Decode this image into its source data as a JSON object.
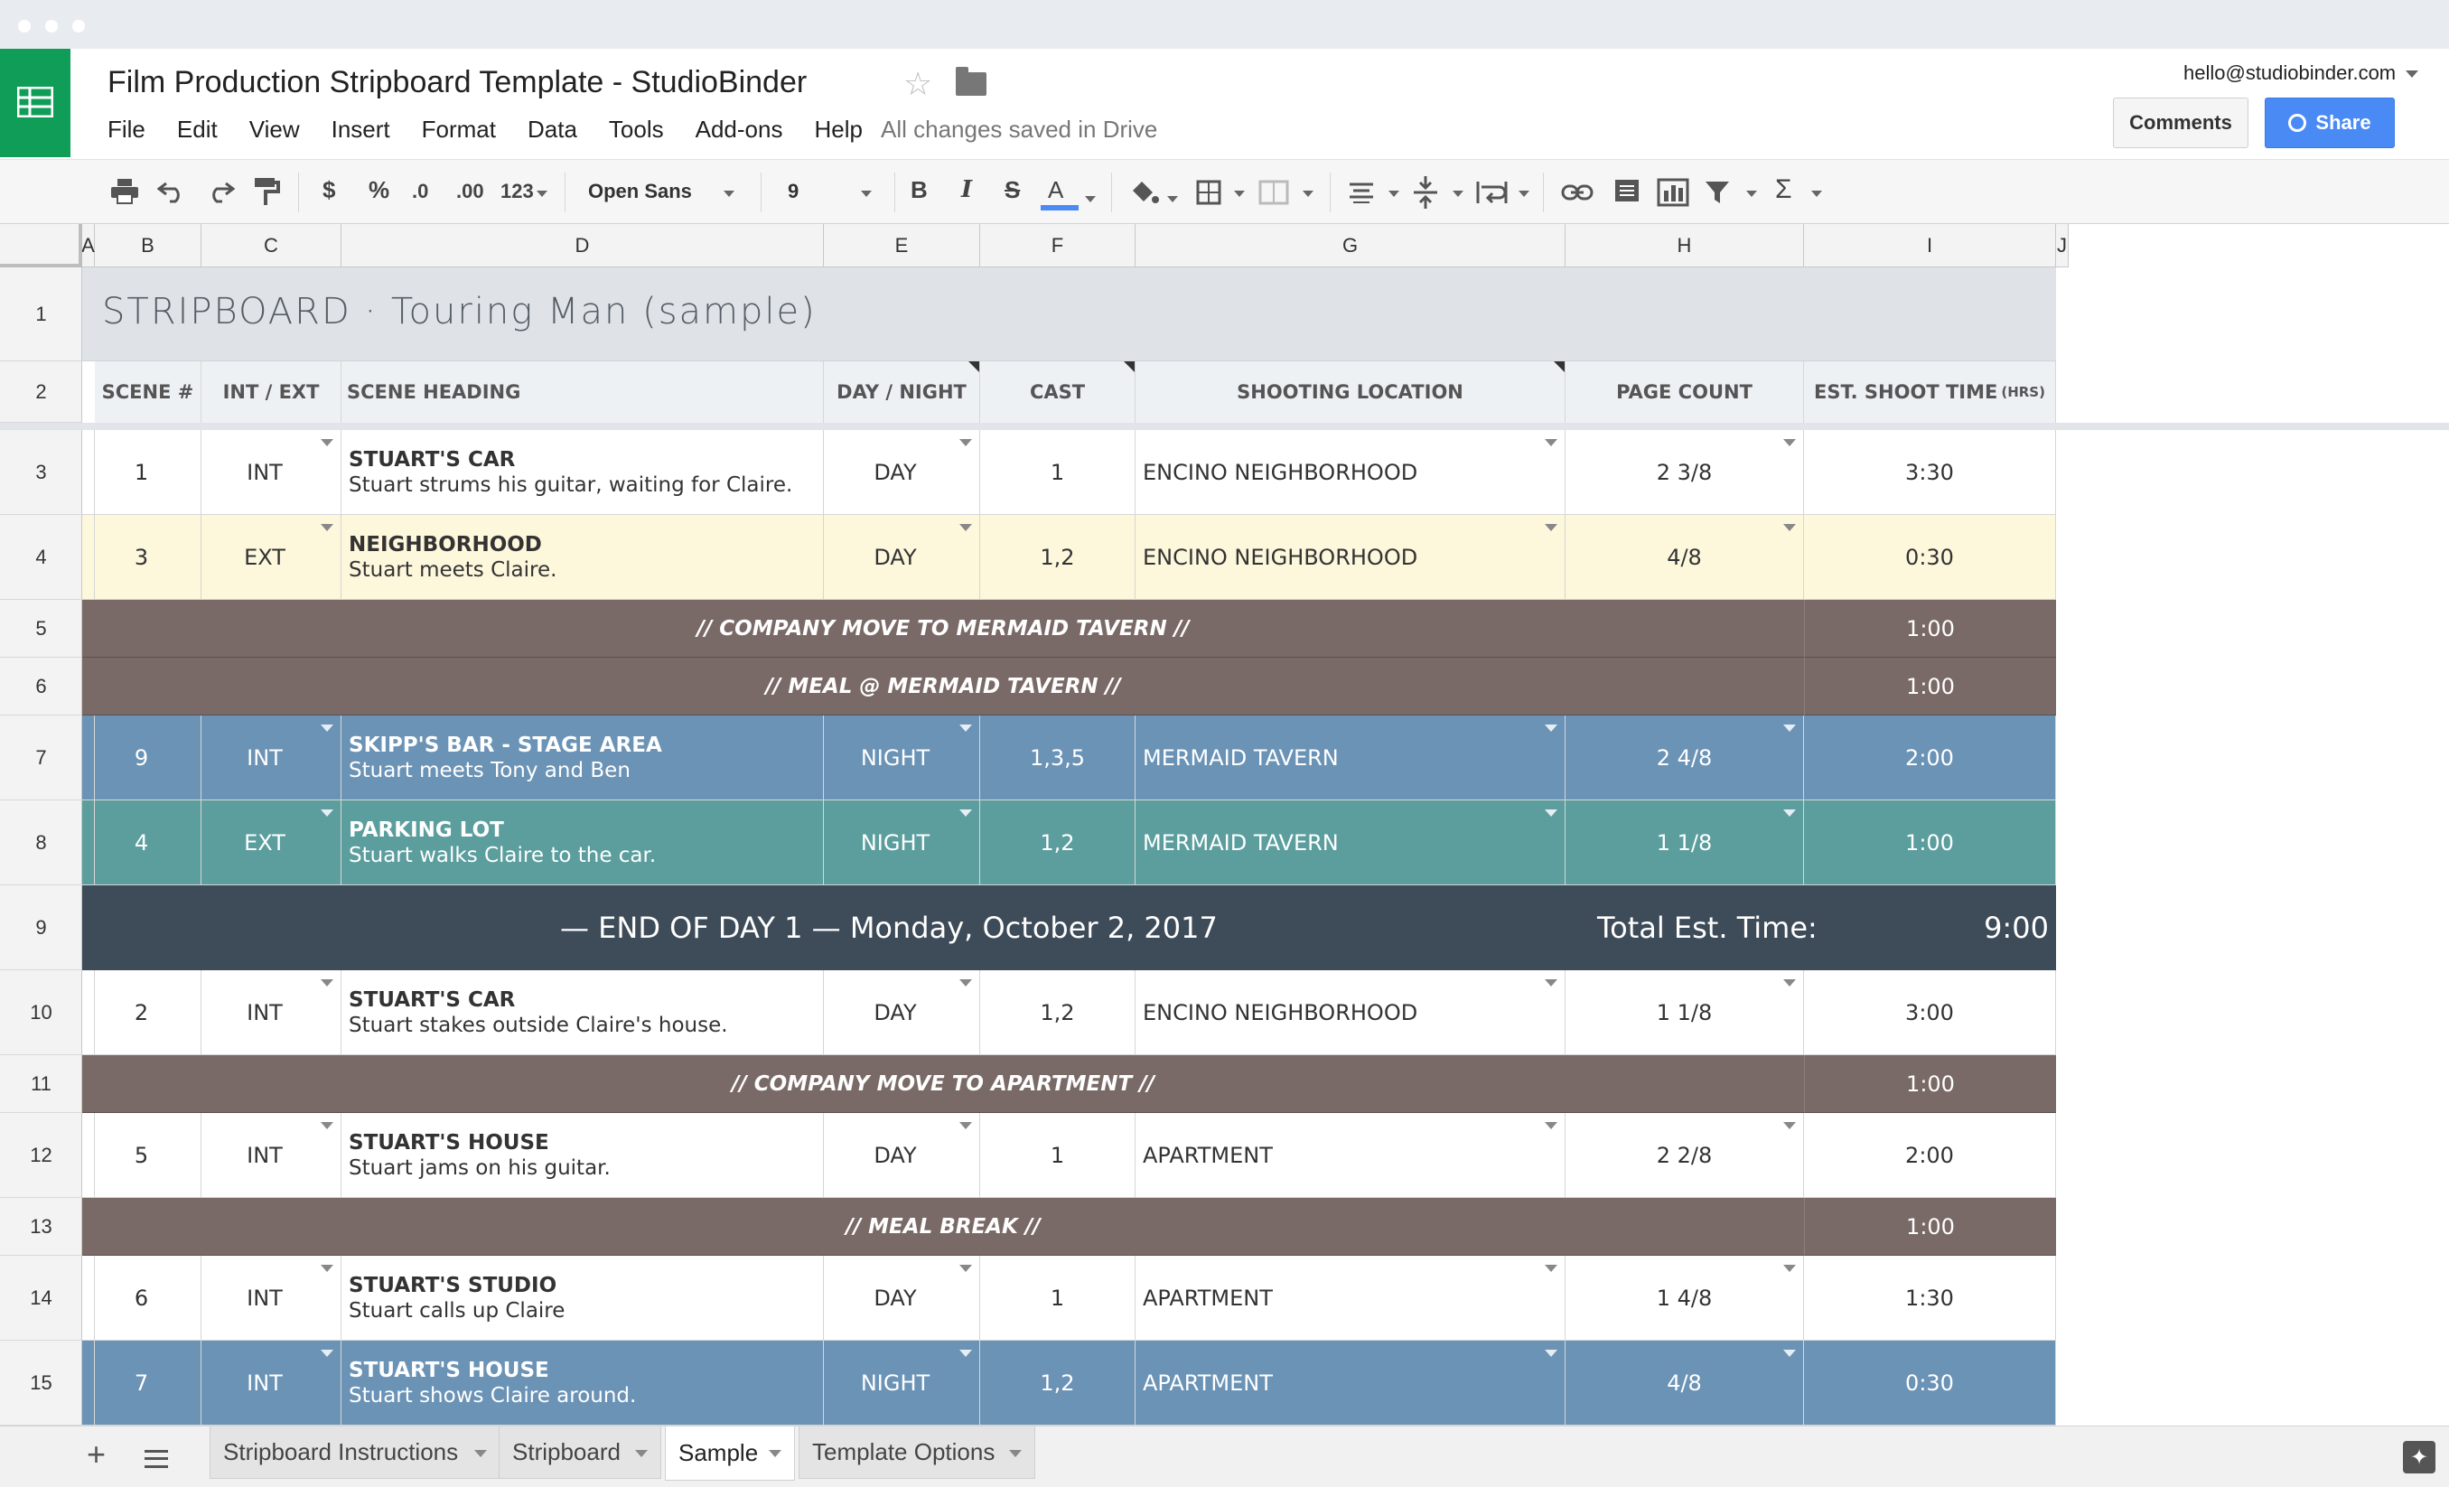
{
  "window": {
    "doc_title": "Film Production Stripboard Template  -  StudioBinder",
    "saved_status": "All changes saved in Drive"
  },
  "menu": [
    "File",
    "Edit",
    "View",
    "Insert",
    "Format",
    "Data",
    "Tools",
    "Add-ons",
    "Help"
  ],
  "account": {
    "email": "hello@studiobinder.com",
    "comments_label": "Comments",
    "share_label": "Share"
  },
  "toolbar": {
    "currency": "$",
    "percent": "%",
    "dec_less": ".0",
    "dec_more": ".00",
    "more_formats": "123",
    "font": "Open Sans",
    "font_size": "9",
    "bold": "B",
    "italic": "I",
    "strike": "S",
    "text_color": "A",
    "functions": "Σ"
  },
  "columns": [
    "A",
    "B",
    "C",
    "D",
    "E",
    "F",
    "G",
    "H",
    "I",
    "J"
  ],
  "row_numbers": [
    "1",
    "2",
    "3",
    "4",
    "5",
    "6",
    "7",
    "8",
    "9",
    "10",
    "11",
    "12",
    "13",
    "14",
    "15"
  ],
  "sheet": {
    "title": "STRIPBOARD · Touring Man (sample)",
    "headers": {
      "scene": "SCENE #",
      "int_ext": "INT / EXT",
      "heading": "SCENE HEADING",
      "day_night": "DAY / NIGHT",
      "cast": "CAST",
      "location": "SHOOTING LOCATION",
      "page_count": "PAGE COUNT",
      "shoot_time": "EST. SHOOT TIME",
      "shoot_time_unit": "(HRS)"
    },
    "rows": [
      {
        "kind": "scene",
        "scene": "1",
        "int_ext": "INT",
        "heading": "STUART'S CAR",
        "desc": "Stuart strums his guitar, waiting for Claire.",
        "dn": "DAY",
        "cast": "1",
        "location": "ENCINO NEIGHBORHOOD",
        "pages": "2 3/8",
        "time": "3:30",
        "color": "#ffffff",
        "text": "#333333"
      },
      {
        "kind": "scene",
        "scene": "3",
        "int_ext": "EXT",
        "heading": "NEIGHBORHOOD",
        "desc": "Stuart meets Claire.",
        "dn": "DAY",
        "cast": "1,2",
        "location": "ENCINO NEIGHBORHOOD",
        "pages": "4/8",
        "time": "0:30",
        "color": "#fdf7dc",
        "text": "#333333"
      },
      {
        "kind": "band",
        "label": "// COMPANY MOVE TO MERMAID TAVERN //",
        "time": "1:00"
      },
      {
        "kind": "band",
        "label": "// MEAL @ MERMAID TAVERN //",
        "time": "1:00"
      },
      {
        "kind": "scene",
        "scene": "9",
        "int_ext": "INT",
        "heading": "SKIPP'S BAR - STAGE AREA",
        "desc": "Stuart meets Tony and Ben",
        "dn": "NIGHT",
        "cast": "1,3,5",
        "location": "MERMAID TAVERN",
        "pages": "2 4/8",
        "time": "2:00",
        "color": "#6b93b6",
        "text": "#ffffff"
      },
      {
        "kind": "scene",
        "scene": "4",
        "int_ext": "EXT",
        "heading": "PARKING LOT",
        "desc": "Stuart walks Claire to the car.",
        "dn": "NIGHT",
        "cast": "1,2",
        "location": "MERMAID TAVERN",
        "pages": "1 1/8",
        "time": "1:00",
        "color": "#5c9e9e",
        "text": "#ffffff"
      },
      {
        "kind": "endday",
        "label": "— END OF DAY 1 —  Monday, October 2, 2017",
        "total_label": "Total Est. Time:",
        "time": "9:00"
      },
      {
        "kind": "scene",
        "scene": "2",
        "int_ext": "INT",
        "heading": "STUART'S CAR",
        "desc": "Stuart stakes outside Claire's house.",
        "dn": "DAY",
        "cast": "1,2",
        "location": "ENCINO NEIGHBORHOOD",
        "pages": "1 1/8",
        "time": "3:00",
        "color": "#ffffff",
        "text": "#333333"
      },
      {
        "kind": "band",
        "label": "// COMPANY MOVE TO APARTMENT //",
        "time": "1:00"
      },
      {
        "kind": "scene",
        "scene": "5",
        "int_ext": "INT",
        "heading": "STUART'S HOUSE",
        "desc": "Stuart jams on his guitar.",
        "dn": "DAY",
        "cast": "1",
        "location": "APARTMENT",
        "pages": "2 2/8",
        "time": "2:00",
        "color": "#ffffff",
        "text": "#333333"
      },
      {
        "kind": "band",
        "label": "// MEAL BREAK //",
        "time": "1:00"
      },
      {
        "kind": "scene",
        "scene": "6",
        "int_ext": "INT",
        "heading": "STUART'S STUDIO",
        "desc": "Stuart calls up Claire",
        "dn": "DAY",
        "cast": "1",
        "location": "APARTMENT",
        "pages": "1 4/8",
        "time": "1:30",
        "color": "#ffffff",
        "text": "#333333"
      },
      {
        "kind": "scene",
        "scene": "7",
        "int_ext": "INT",
        "heading": "STUART'S HOUSE",
        "desc": "Stuart shows Claire around.",
        "dn": "NIGHT",
        "cast": "1,2",
        "location": "APARTMENT",
        "pages": "4/8",
        "time": "0:30",
        "color": "#6b93b6",
        "text": "#ffffff"
      }
    ],
    "band_color": "#7a6a67",
    "endday_color": "#3e4b59"
  },
  "sheet_tabs": [
    "Stripboard Instructions",
    "Stripboard",
    "Sample",
    "Template Options"
  ],
  "active_sheet_tab": "Sample"
}
